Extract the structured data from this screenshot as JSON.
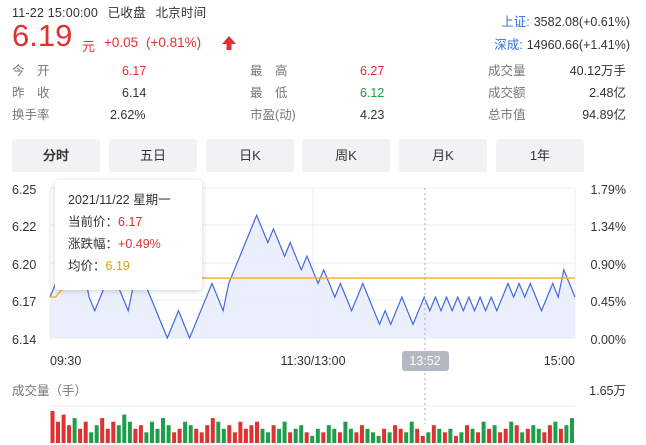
{
  "status": {
    "datetime": "11-22 15:00:00",
    "state": "已收盘",
    "timezone": "北京时间"
  },
  "quote": {
    "price": "6.19",
    "unit": "元",
    "change": "+0.05",
    "change_pct": "(+0.81%)"
  },
  "indices": [
    {
      "label": "上证:",
      "value": "3582.08(+0.61%)"
    },
    {
      "label": "深成:",
      "value": "14960.66(+1.41%)"
    }
  ],
  "stats": {
    "open_label": "今　开",
    "open": "6.17",
    "prev_label": "昨　收",
    "prev": "6.14",
    "turnover_label": "换手率",
    "turnover": "2.62%",
    "high_label": "最　高",
    "high": "6.27",
    "low_label": "最　低",
    "low": "6.12",
    "pe_label": "市盈(动)",
    "pe": "4.23",
    "volume_label": "成交量",
    "volume": "40.12万手",
    "amount_label": "成交额",
    "amount": "2.48亿",
    "mcap_label": "总市值",
    "mcap": "94.89亿"
  },
  "tabs": [
    "分时",
    "五日",
    "日K",
    "周K",
    "月K",
    "1年"
  ],
  "active_tab": "分时",
  "tooltip": {
    "date": "2021/11/22 星期一",
    "price_label": "当前价：",
    "price": "6.17",
    "chg_label": "涨跌幅：",
    "chg": "+0.49%",
    "avg_label": "均价：",
    "avg": "6.19"
  },
  "volume_label": "成交量（手）",
  "colors": {
    "up": "#e03131",
    "down": "#1e9e4a",
    "line": "#4169e1",
    "avg": "#f0b429",
    "fill": "#e8edfb"
  },
  "chart_data": {
    "type": "line",
    "y_ticks_left": [
      "6.25",
      "6.22",
      "6.20",
      "6.17",
      "6.14"
    ],
    "y_ticks_right": [
      "1.79%",
      "1.34%",
      "0.90%",
      "0.45%",
      "0.00%"
    ],
    "x_ticks": [
      "09:30",
      "11:30/13:00",
      "15:00"
    ],
    "crosshair_time": "13:52",
    "ylim": [
      6.14,
      6.25
    ],
    "prev_close": 6.14,
    "volume_max_label": "1.65万",
    "series": [
      {
        "values": [
          6.17,
          6.18,
          6.18,
          6.19,
          6.18,
          6.18,
          6.19,
          6.17,
          6.16,
          6.17,
          6.18,
          6.19,
          6.18,
          6.17,
          6.16,
          6.18,
          6.19,
          6.18,
          6.17,
          6.16,
          6.15,
          6.14,
          6.15,
          6.16,
          6.15,
          6.14,
          6.15,
          6.16,
          6.17,
          6.18,
          6.17,
          6.16,
          6.18,
          6.19,
          6.2,
          6.21,
          6.22,
          6.23,
          6.22,
          6.21,
          6.22,
          6.21,
          6.2,
          6.21,
          6.2,
          6.19,
          6.2,
          6.19,
          6.18,
          6.19,
          6.18,
          6.17,
          6.18,
          6.17,
          6.16,
          6.17,
          6.18,
          6.17,
          6.16,
          6.15,
          6.16,
          6.15,
          6.16,
          6.17,
          6.16,
          6.15,
          6.16,
          6.17,
          6.16,
          6.17,
          6.16,
          6.17,
          6.16,
          6.17,
          6.16,
          6.17,
          6.16,
          6.17,
          6.16,
          6.17,
          6.16,
          6.17,
          6.18,
          6.17,
          6.18,
          6.17,
          6.18,
          6.17,
          6.16,
          6.17,
          6.18,
          6.17,
          6.19,
          6.18,
          6.17
        ]
      },
      {
        "values": [
          6.17,
          6.17,
          6.175,
          6.178,
          6.18,
          6.181,
          6.182,
          6.182,
          6.183,
          6.183,
          6.184,
          6.184,
          6.184,
          6.184,
          6.184,
          6.184,
          6.184,
          6.184,
          6.184,
          6.184,
          6.184,
          6.184,
          6.184,
          6.184,
          6.184,
          6.184,
          6.184,
          6.184,
          6.184,
          6.184,
          6.184,
          6.184,
          6.184,
          6.184,
          6.184,
          6.184,
          6.184,
          6.184,
          6.184,
          6.184,
          6.184,
          6.184,
          6.184,
          6.184,
          6.184,
          6.184,
          6.184,
          6.184,
          6.184,
          6.184,
          6.184,
          6.184,
          6.184,
          6.184,
          6.184,
          6.184,
          6.184,
          6.184,
          6.184,
          6.184,
          6.184,
          6.184,
          6.184,
          6.184,
          6.184,
          6.184,
          6.184,
          6.184,
          6.184,
          6.184,
          6.184,
          6.184,
          6.184,
          6.184,
          6.184,
          6.184,
          6.184,
          6.184,
          6.184,
          6.184,
          6.184,
          6.184,
          6.184,
          6.184,
          6.184,
          6.184,
          6.184,
          6.184,
          6.184,
          6.184,
          6.184,
          6.184,
          6.184,
          6.184,
          6.184
        ]
      }
    ],
    "volume": [
      9,
      6,
      8,
      5,
      7,
      4,
      6,
      3,
      5,
      7,
      4,
      6,
      5,
      8,
      6,
      4,
      5,
      3,
      6,
      4,
      7,
      5,
      3,
      4,
      6,
      5,
      4,
      3,
      5,
      7,
      6,
      4,
      5,
      3,
      6,
      4,
      5,
      6,
      4,
      3,
      5,
      4,
      6,
      3,
      4,
      5,
      3,
      2,
      4,
      3,
      5,
      4,
      3,
      6,
      4,
      3,
      5,
      4,
      3,
      2,
      4,
      3,
      5,
      4,
      3,
      6,
      4,
      2,
      3,
      5,
      4,
      3,
      4,
      2,
      3,
      5,
      4,
      3,
      6,
      4,
      5,
      3,
      4,
      6,
      5,
      3,
      4,
      5,
      4,
      3,
      5,
      6,
      4,
      5,
      7
    ]
  }
}
